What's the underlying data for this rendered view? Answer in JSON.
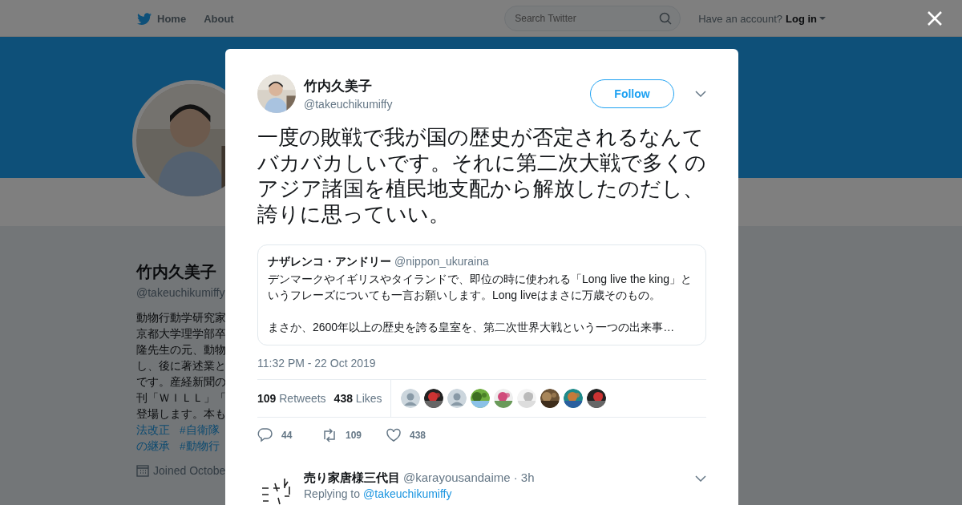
{
  "top_nav": {
    "links": [
      "Home",
      "About"
    ],
    "search": {
      "placeholder": "Search Twitter"
    },
    "account_prompt": "Have an account?",
    "login": "Log in"
  },
  "profile": {
    "name": "竹内久美子",
    "handle": "@takeuchikumiffy",
    "bio_lines": [
      "動物行動学研究家",
      "京都大学理学部卒",
      "隆先生の元、動物",
      "し、後に著述業と",
      "です。産経新聞の",
      "刊「ＷＩＬＬ」「",
      "登場します。本も"
    ],
    "hashtag_lines": [
      [
        "法改正",
        "#自衛隊"
      ],
      [
        "の継承",
        "#動物行"
      ]
    ],
    "joined": "Joined Octobe"
  },
  "tweet": {
    "author": {
      "name": "竹内久美子",
      "handle": "@takeuchikumiffy"
    },
    "follow_button": "Follow",
    "text": "一度の敗戦で我が国の歴史が否定されるなんてバカバカしいです。それに第二次大戦で多くのアジア諸国を植民地支配から解放したのだし、誇りに思っていい。",
    "quoted": {
      "name": "ナザレンコ・アンドリー",
      "handle": "@nippon_ukuraina",
      "paragraphs": [
        "デンマークやイギリスやタイランドで、即位の時に使われる「Long live the king」というフレーズについても一言お願いします。Long liveはまさに万歳そのもの。",
        "まさか、2600年以上の歴史を誇る皇室を、第二次世界大戦という一つの出来事…"
      ]
    },
    "timestamp": "11:32 PM - 22 Oct 2019",
    "stats": [
      {
        "count": "109",
        "label": "Retweets"
      },
      {
        "count": "438",
        "label": "Likes"
      }
    ],
    "liker_avatars": [
      {
        "kind": "default"
      },
      {
        "kind": "picture"
      },
      {
        "kind": "default"
      },
      {
        "kind": "picture"
      },
      {
        "kind": "picture"
      },
      {
        "kind": "picture"
      },
      {
        "kind": "picture"
      },
      {
        "kind": "picture"
      },
      {
        "kind": "picture"
      }
    ],
    "actions": [
      {
        "kind": "reply",
        "count": "44"
      },
      {
        "kind": "retweet",
        "count": "109"
      },
      {
        "kind": "like",
        "count": "438"
      }
    ]
  },
  "replies": [
    {
      "name": "売り家唐様三代目",
      "handle": "@karayousandaime",
      "time": "· 3h",
      "replying_to_label": "Replying to",
      "replying_to": "@takeuchikumiffy"
    }
  ]
}
